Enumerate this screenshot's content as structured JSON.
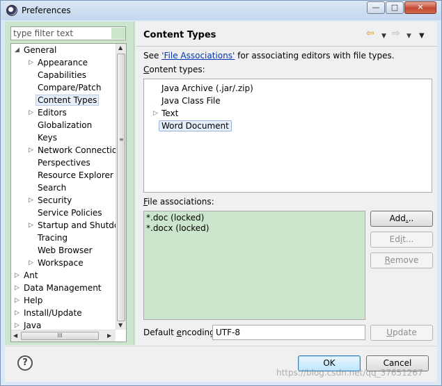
{
  "window": {
    "title": "Preferences",
    "min_glyph": "—",
    "max_glyph": "□",
    "close_glyph": "✕"
  },
  "filter": {
    "placeholder": "type filter text"
  },
  "tree": {
    "items": [
      {
        "label": "General",
        "expander": "◢"
      },
      {
        "label": "Appearance",
        "expander": "▷"
      },
      {
        "label": "Capabilities",
        "expander": ""
      },
      {
        "label": "Compare/Patch",
        "expander": ""
      },
      {
        "label": "Content Types",
        "expander": ""
      },
      {
        "label": "Editors",
        "expander": "▷"
      },
      {
        "label": "Globalization",
        "expander": ""
      },
      {
        "label": "Keys",
        "expander": ""
      },
      {
        "label": "Network Connections",
        "expander": "▷"
      },
      {
        "label": "Perspectives",
        "expander": ""
      },
      {
        "label": "Resource Explorer",
        "expander": ""
      },
      {
        "label": "Search",
        "expander": ""
      },
      {
        "label": "Security",
        "expander": "▷"
      },
      {
        "label": "Service Policies",
        "expander": ""
      },
      {
        "label": "Startup and Shutdown",
        "expander": "▷"
      },
      {
        "label": "Tracing",
        "expander": ""
      },
      {
        "label": "Web Browser",
        "expander": ""
      },
      {
        "label": "Workspace",
        "expander": "▷"
      },
      {
        "label": "Ant",
        "expander": "▷"
      },
      {
        "label": "Data Management",
        "expander": "▷"
      },
      {
        "label": "Help",
        "expander": "▷"
      },
      {
        "label": "Install/Update",
        "expander": "▷"
      },
      {
        "label": "Java",
        "expander": "▷"
      }
    ]
  },
  "page": {
    "title": "Content Types",
    "desc_prefix": "See ",
    "desc_link": "'File Associations'",
    "desc_suffix": " for associating editors with file types.",
    "content_types_label_u": "C",
    "content_types_label_rest": "ontent types:",
    "content_types": [
      {
        "label": "Java Archive (.jar/.zip)",
        "expander": ""
      },
      {
        "label": "Java Class File",
        "expander": ""
      },
      {
        "label": "Text",
        "expander": "▷"
      },
      {
        "label": "Word Document",
        "expander": ""
      }
    ],
    "file_assoc_label_u": "F",
    "file_assoc_label_rest": "ile associations:",
    "associations": [
      "*.doc (locked)",
      "*.docx (locked)"
    ],
    "add_label_pre": "Add",
    "add_label_u": ".",
    "add_label_post": "..",
    "edit_label_pre": "Ed",
    "edit_label_u": "i",
    "edit_label_post": "t...",
    "remove_label_pre": "",
    "remove_label_u": "R",
    "remove_label_post": "emove",
    "encoding_label_pre": "Default ",
    "encoding_label_u": "e",
    "encoding_label_post": "ncoding:",
    "encoding_value": "UTF-8",
    "update_label_pre": "",
    "update_label_u": "U",
    "update_label_post": "pdate"
  },
  "nav": {
    "back_glyph": "⇦",
    "dd_glyph": "▼",
    "fwd_glyph": "⇨",
    "menu_glyph": "▼"
  },
  "footer": {
    "help_glyph": "?",
    "ok_label": "OK",
    "cancel_label": "Cancel",
    "watermark": "https://blog.csdn.net/qq_37651267"
  },
  "scroll": {
    "up": "▲",
    "down": "▼",
    "left": "◀",
    "right": "▶",
    "grip_v": "≡",
    "grip_h": "III"
  }
}
